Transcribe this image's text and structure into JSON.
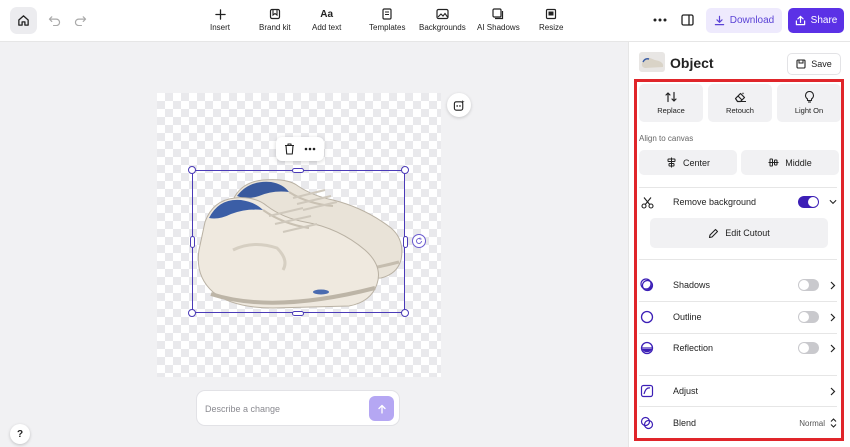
{
  "toolbar": {
    "tools": [
      {
        "id": "insert",
        "label": "Insert",
        "icon": "plus-icon"
      },
      {
        "id": "brand-kit",
        "label": "Brand kit",
        "icon": "brand-kit-icon"
      },
      {
        "id": "add-text",
        "label": "Add text",
        "icon": "text-icon"
      },
      {
        "id": "templates",
        "label": "Templates",
        "icon": "templates-icon"
      },
      {
        "id": "backgrounds",
        "label": "Backgrounds",
        "icon": "backgrounds-icon"
      },
      {
        "id": "ai-shadows",
        "label": "AI Shadows",
        "icon": "shadows-icon"
      },
      {
        "id": "resize",
        "label": "Resize",
        "icon": "resize-icon"
      }
    ],
    "download_label": "Download",
    "share_label": "Share"
  },
  "canvas": {
    "prompt_placeholder": "Describe a change",
    "help_label": "?"
  },
  "panel": {
    "title": "Object",
    "save_label": "Save",
    "actions": [
      {
        "id": "replace",
        "label": "Replace",
        "icon": "replace-icon"
      },
      {
        "id": "retouch",
        "label": "Retouch",
        "icon": "eraser-icon"
      },
      {
        "id": "light-on",
        "label": "Light On",
        "icon": "lightbulb-icon"
      }
    ],
    "align_label": "Align to canvas",
    "align_center_label": "Center",
    "align_middle_label": "Middle",
    "remove_background_label": "Remove background",
    "remove_background_on": true,
    "edit_cutout_label": "Edit Cutout",
    "shadows_label": "Shadows",
    "shadows_on": false,
    "outline_label": "Outline",
    "outline_on": false,
    "reflection_label": "Reflection",
    "reflection_on": false,
    "adjust_label": "Adjust",
    "blend_label": "Blend",
    "blend_value": "Normal"
  },
  "colors": {
    "accent": "#5b31e6",
    "toggle_on": "#3c1fb6",
    "selection": "#4b3bb8",
    "highlight_frame": "#e0252a"
  }
}
